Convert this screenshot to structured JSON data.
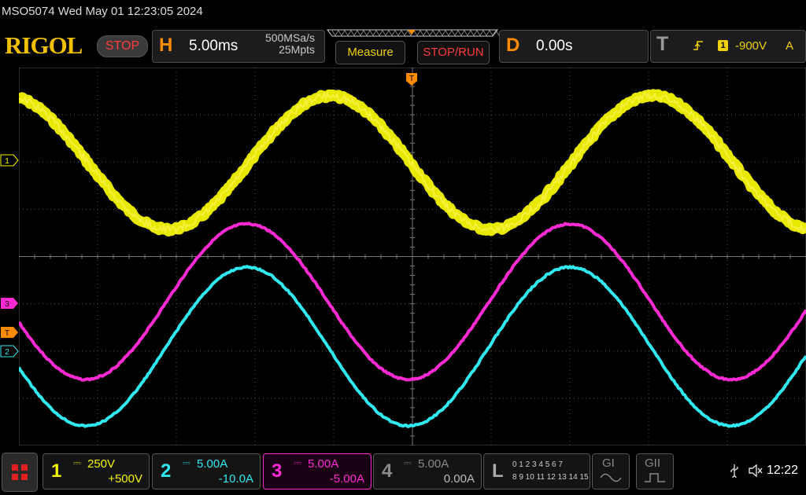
{
  "status": {
    "text": "MSO5074  Wed May 01 12:23:05 2024"
  },
  "header": {
    "logo": "RIGOL",
    "run_state": "STOP",
    "horizontal": {
      "letter": "H",
      "timebase": "5.00ms",
      "sample_rate": "500MSa/s",
      "memory_depth": "25Mpts"
    },
    "measure_label": "Measure",
    "stop_run_label": "STOP/RUN",
    "delay": {
      "letter": "D",
      "value": "0.00s"
    },
    "trigger": {
      "letter": "T",
      "source": "1",
      "level": "-900V",
      "mode": "A",
      "slope_icon": "rising-edge-icon"
    }
  },
  "markers": {
    "ch1": "1",
    "ch3": "3",
    "trigger": "T",
    "ch2": "2",
    "trigger_position": "T"
  },
  "channels": [
    {
      "num": "1",
      "scale": "250V",
      "offset": "+500V",
      "color": "#f5f500"
    },
    {
      "num": "2",
      "scale": "5.00A",
      "offset": "-10.0A",
      "color": "#30e8f0"
    },
    {
      "num": "3",
      "scale": "5.00A",
      "offset": "-5.00A",
      "color": "#ff2ad4"
    },
    {
      "num": "4",
      "scale": "5.00A",
      "offset": "0.00A",
      "color": "#8a8a8a"
    }
  ],
  "logic": {
    "letter": "L",
    "row1": "0 1 2 3  4 5 6 7",
    "row2": "8 9 10 11  12 13 14 15"
  },
  "generators": {
    "g1": "GI",
    "g2": "GII"
  },
  "system": {
    "time": "12:22"
  },
  "colors": {
    "ch1": "#f5f500",
    "ch2": "#30e8f0",
    "ch3": "#ff2ad4",
    "accent": "#ff8c00",
    "stop": "#ff3b3b"
  }
}
